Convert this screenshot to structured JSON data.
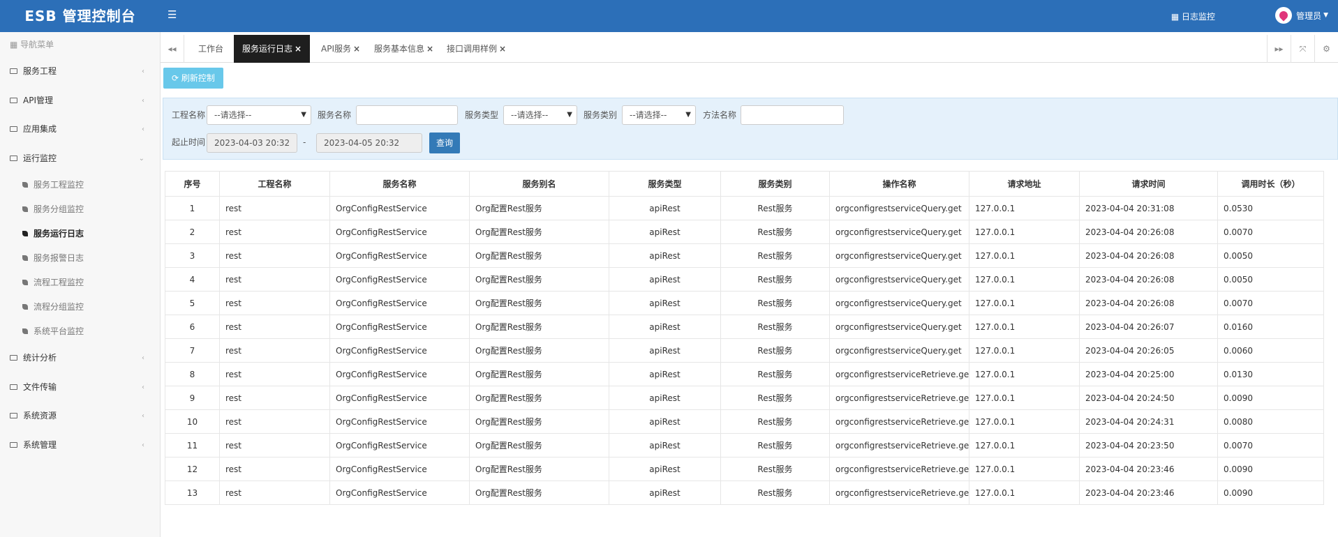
{
  "header": {
    "title": "ESB 管理控制台",
    "menu_icon": "☰",
    "log_monitor": "日志监控",
    "user": "管理员"
  },
  "sidebar": {
    "header": "导航菜单",
    "groups_top": [
      {
        "label": "服务工程"
      },
      {
        "label": "API管理"
      },
      {
        "label": "应用集成"
      },
      {
        "label": "运行监控"
      }
    ],
    "sub_items": [
      {
        "label": "服务工程监控"
      },
      {
        "label": "服务分组监控"
      },
      {
        "label": "服务运行日志"
      },
      {
        "label": "服务报警日志"
      },
      {
        "label": "流程工程监控"
      },
      {
        "label": "流程分组监控"
      },
      {
        "label": "系统平台监控"
      }
    ],
    "groups_bottom": [
      {
        "label": "统计分析"
      },
      {
        "label": "文件传输"
      },
      {
        "label": "系统资源"
      },
      {
        "label": "系统管理"
      }
    ]
  },
  "tabs": [
    {
      "label": "工作台",
      "closable": false
    },
    {
      "label": "服务运行日志",
      "closable": true,
      "active": true
    },
    {
      "label": "API服务",
      "closable": true
    },
    {
      "label": "服务基本信息",
      "closable": true
    },
    {
      "label": "接口调用样例",
      "closable": true
    }
  ],
  "toolbar": {
    "refresh_label": "刷新控制"
  },
  "filter": {
    "project_label": "工程名称",
    "project_value": "--请选择--",
    "service_name_label": "服务名称",
    "service_name_value": "",
    "service_type_label": "服务类型",
    "service_type_value": "--请选择--",
    "service_category_label": "服务类别",
    "service_category_value": "--请选择--",
    "method_label": "方法名称",
    "method_value": "",
    "time_label": "起止时间",
    "start_time": "2023-04-03 20:32",
    "time_sep": "-",
    "end_time": "2023-04-05 20:32",
    "query_label": "查询"
  },
  "table": {
    "columns": [
      "序号",
      "工程名称",
      "服务名称",
      "服务别名",
      "服务类型",
      "服务类别",
      "操作名称",
      "请求地址",
      "请求时间",
      "调用时长（秒）"
    ],
    "rows": [
      [
        "1",
        "rest",
        "OrgConfigRestService",
        "Org配置Rest服务",
        "apiRest",
        "Rest服务",
        "orgconfigrestserviceQuery.get",
        "127.0.0.1",
        "2023-04-04 20:31:08",
        "0.0530"
      ],
      [
        "2",
        "rest",
        "OrgConfigRestService",
        "Org配置Rest服务",
        "apiRest",
        "Rest服务",
        "orgconfigrestserviceQuery.get",
        "127.0.0.1",
        "2023-04-04 20:26:08",
        "0.0070"
      ],
      [
        "3",
        "rest",
        "OrgConfigRestService",
        "Org配置Rest服务",
        "apiRest",
        "Rest服务",
        "orgconfigrestserviceQuery.get",
        "127.0.0.1",
        "2023-04-04 20:26:08",
        "0.0050"
      ],
      [
        "4",
        "rest",
        "OrgConfigRestService",
        "Org配置Rest服务",
        "apiRest",
        "Rest服务",
        "orgconfigrestserviceQuery.get",
        "127.0.0.1",
        "2023-04-04 20:26:08",
        "0.0050"
      ],
      [
        "5",
        "rest",
        "OrgConfigRestService",
        "Org配置Rest服务",
        "apiRest",
        "Rest服务",
        "orgconfigrestserviceQuery.get",
        "127.0.0.1",
        "2023-04-04 20:26:08",
        "0.0070"
      ],
      [
        "6",
        "rest",
        "OrgConfigRestService",
        "Org配置Rest服务",
        "apiRest",
        "Rest服务",
        "orgconfigrestserviceQuery.get",
        "127.0.0.1",
        "2023-04-04 20:26:07",
        "0.0160"
      ],
      [
        "7",
        "rest",
        "OrgConfigRestService",
        "Org配置Rest服务",
        "apiRest",
        "Rest服务",
        "orgconfigrestserviceQuery.get",
        "127.0.0.1",
        "2023-04-04 20:26:05",
        "0.0060"
      ],
      [
        "8",
        "rest",
        "OrgConfigRestService",
        "Org配置Rest服务",
        "apiRest",
        "Rest服务",
        "orgconfigrestserviceRetrieve.ge",
        "127.0.0.1",
        "2023-04-04 20:25:00",
        "0.0130"
      ],
      [
        "9",
        "rest",
        "OrgConfigRestService",
        "Org配置Rest服务",
        "apiRest",
        "Rest服务",
        "orgconfigrestserviceRetrieve.ge",
        "127.0.0.1",
        "2023-04-04 20:24:50",
        "0.0090"
      ],
      [
        "10",
        "rest",
        "OrgConfigRestService",
        "Org配置Rest服务",
        "apiRest",
        "Rest服务",
        "orgconfigrestserviceRetrieve.ge",
        "127.0.0.1",
        "2023-04-04 20:24:31",
        "0.0080"
      ],
      [
        "11",
        "rest",
        "OrgConfigRestService",
        "Org配置Rest服务",
        "apiRest",
        "Rest服务",
        "orgconfigrestserviceRetrieve.ge",
        "127.0.0.1",
        "2023-04-04 20:23:50",
        "0.0070"
      ],
      [
        "12",
        "rest",
        "OrgConfigRestService",
        "Org配置Rest服务",
        "apiRest",
        "Rest服务",
        "orgconfigrestserviceRetrieve.ge",
        "127.0.0.1",
        "2023-04-04 20:23:46",
        "0.0090"
      ],
      [
        "13",
        "rest",
        "OrgConfigRestService",
        "Org配置Rest服务",
        "apiRest",
        "Rest服务",
        "orgconfigrestserviceRetrieve.ge",
        "127.0.0.1",
        "2023-04-04 20:23:46",
        "0.0090"
      ]
    ]
  },
  "colors": {
    "brand": "#2c6fb8",
    "active_tab": "#1e1e1e",
    "refresh": "#68c8ea",
    "query": "#337ab7",
    "filter_bg": "#e5f1fb"
  }
}
